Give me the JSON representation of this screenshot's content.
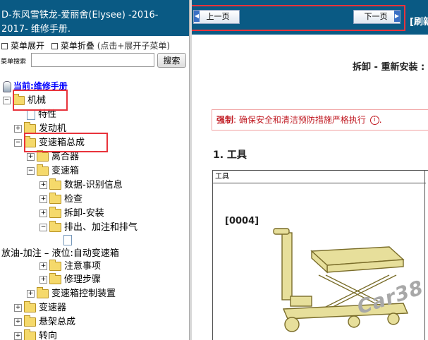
{
  "left_header": {
    "line1": "D-东风雪铁龙-爱丽舍(Elysee)    -2016-",
    "line2": "2017- 维修手册."
  },
  "menu_controls": {
    "expand_label": "菜单展开",
    "collapse_label": "菜单折叠",
    "hint": "(点击+展开子菜单)"
  },
  "search": {
    "label": "菜单搜索",
    "value": "",
    "button_label": "搜索"
  },
  "tree": {
    "current_label": "当前:维修手册",
    "items": [
      {
        "label": "机械"
      },
      {
        "label": "特性"
      },
      {
        "label": "发动机"
      },
      {
        "label": "变速箱总成"
      },
      {
        "label": "离合器"
      },
      {
        "label": "变速箱"
      },
      {
        "label": "数据-识别信息"
      },
      {
        "label": "检查"
      },
      {
        "label": "拆卸-安装"
      },
      {
        "label": "排出、加注和排气"
      },
      {
        "label": "放油-加注 – 液位:自动变速箱"
      },
      {
        "label": "注意事项"
      },
      {
        "label": "修理步骤"
      },
      {
        "label": "变速箱控制装置"
      },
      {
        "label": "变速器"
      },
      {
        "label": "悬架总成"
      },
      {
        "label": "转向"
      }
    ]
  },
  "nav": {
    "prev_label": "上一页",
    "next_label": "下一页",
    "refresh_label": "[刷新"
  },
  "content": {
    "heading": "拆卸 - 重新安装 :",
    "warning_severity": "强制",
    "warning_text": ": 确保安全和清洁预防措施严格执行",
    "section_title": "1. 工具",
    "table_header": "工具",
    "tool_code": "[0004]"
  },
  "watermark": "Car38"
}
